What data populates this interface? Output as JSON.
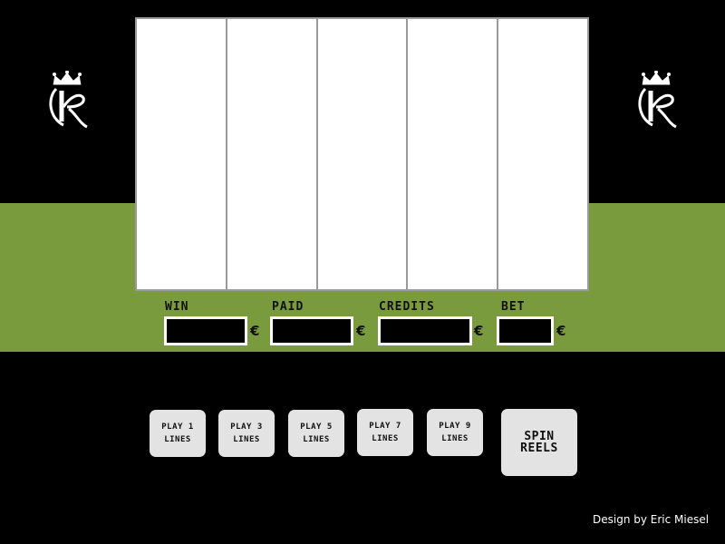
{
  "colors": {
    "background": "#000000",
    "band": "#7a9a3e",
    "reel": "#ffffff",
    "button": "#e3e3e3"
  },
  "logos": [
    "crown-k-logo",
    "crown-k-logo"
  ],
  "reels": [
    "",
    "",
    "",
    "",
    ""
  ],
  "meters": {
    "win": {
      "label": "WIN",
      "value": "",
      "currency": "€"
    },
    "paid": {
      "label": "PAID",
      "value": "",
      "currency": "€"
    },
    "credits": {
      "label": "CREDITS",
      "value": "",
      "currency": "€"
    },
    "bet": {
      "label": "BET",
      "value": "",
      "currency": "€"
    }
  },
  "buttons": {
    "play1": "PLAY 1\nLINES",
    "play3": "PLAY 3\nLINES",
    "play5": "PLAY 5\nLINES",
    "play7": "PLAY 7\nLINES",
    "play9": "PLAY 9\nLINES",
    "spin": "SPIN\nREELS"
  },
  "footer": {
    "credit": "Design by Eric Miesel"
  }
}
